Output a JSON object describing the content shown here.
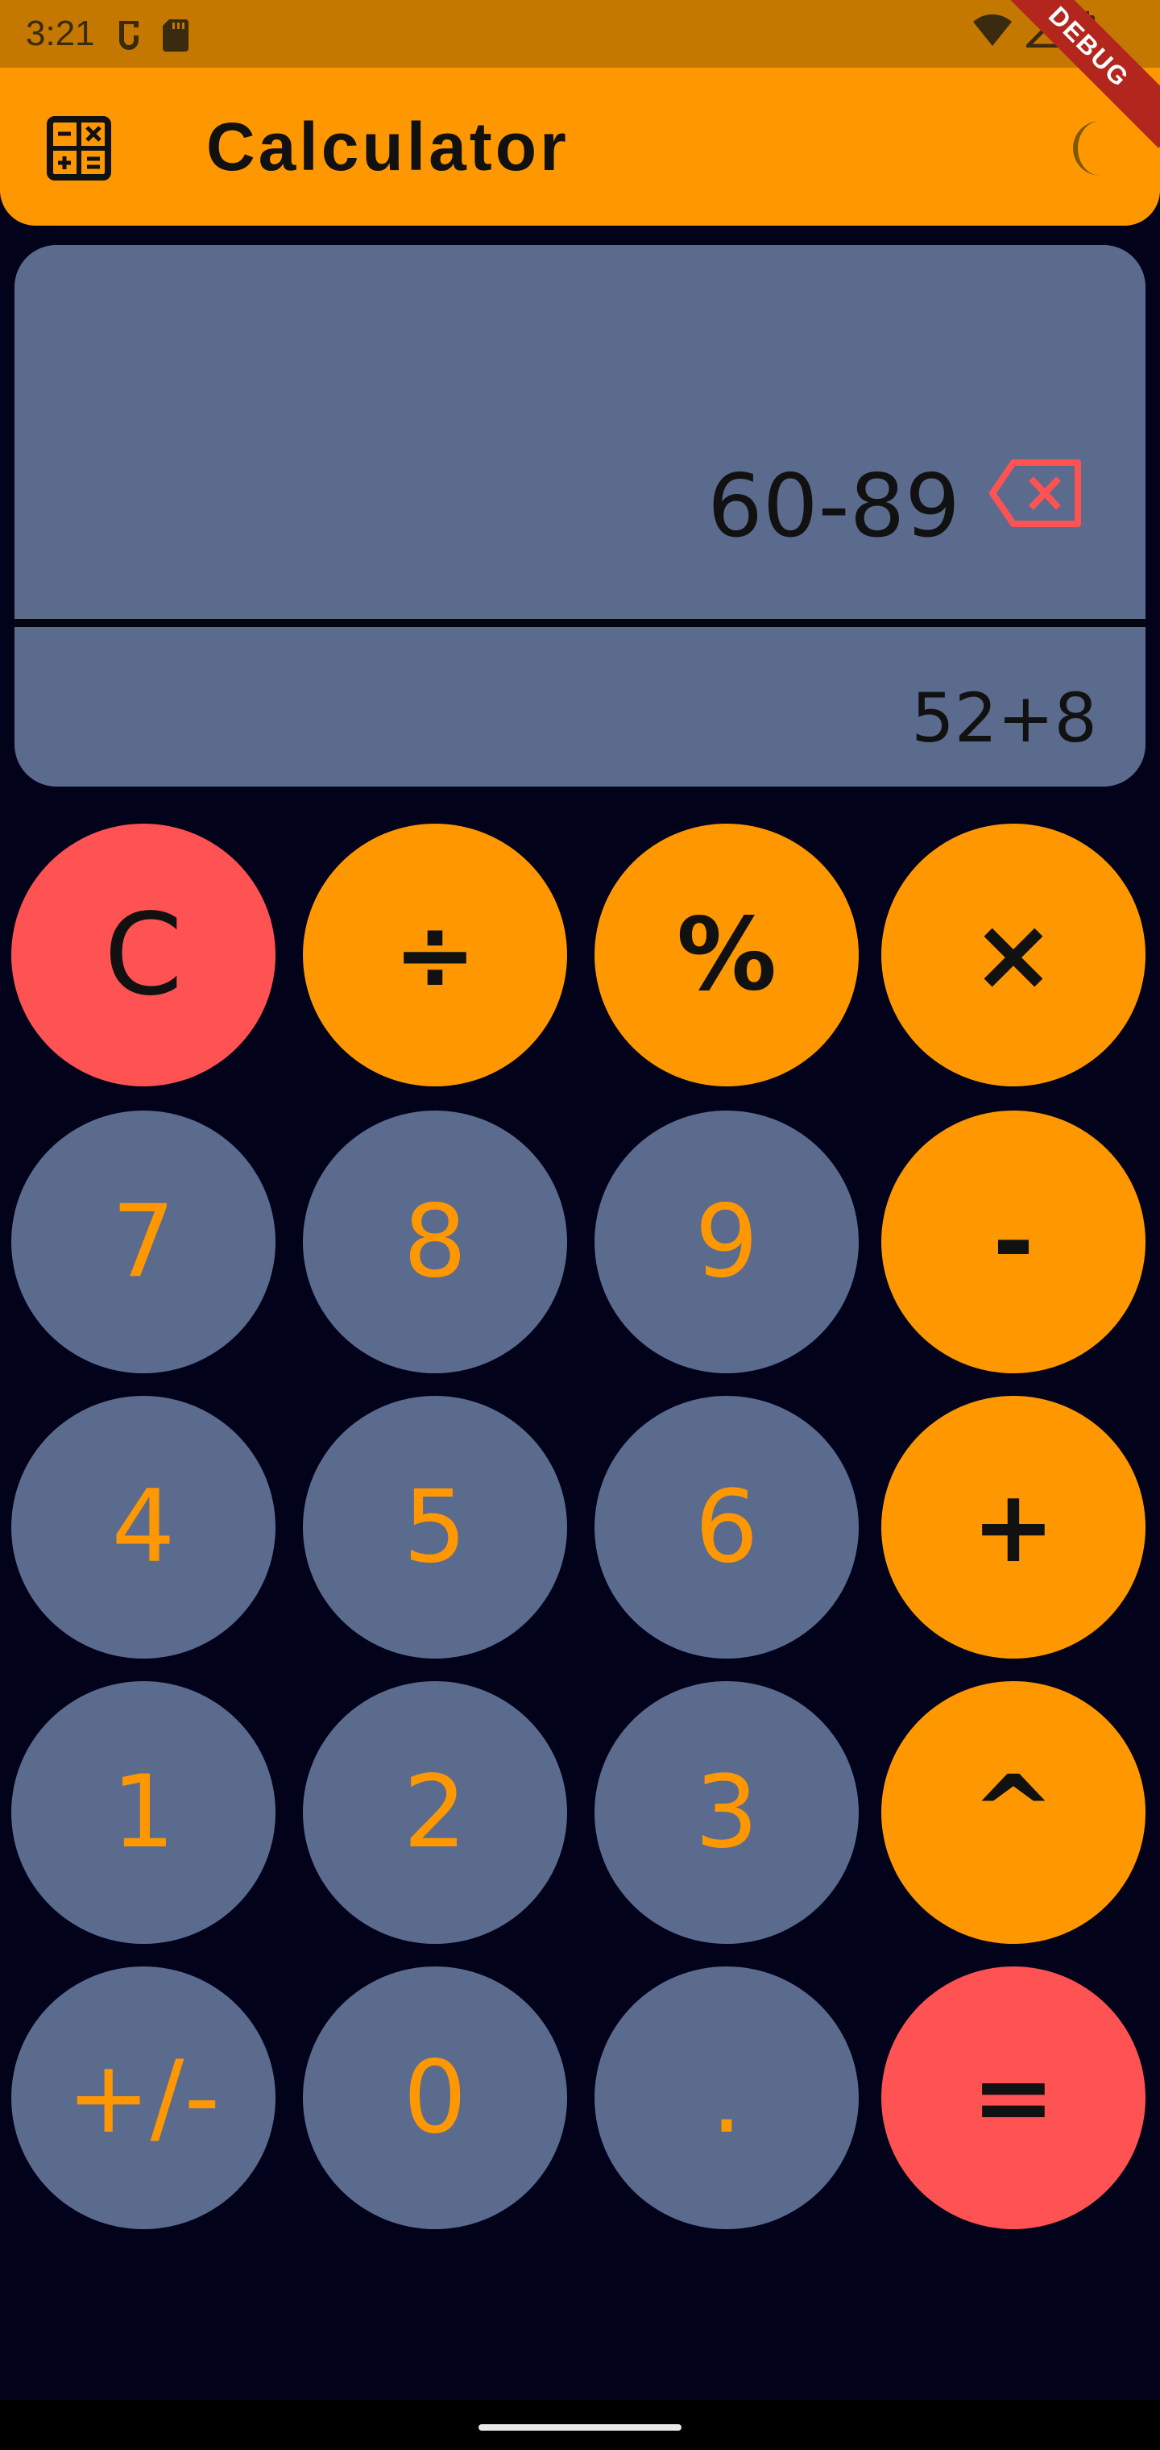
{
  "status_bar": {
    "time": "3:21",
    "icons": [
      "sim-icon",
      "sd-card-icon",
      "wifi-icon",
      "signal-icon",
      "battery-icon"
    ]
  },
  "app_bar": {
    "title": "Calculator",
    "leading_icon": "calculator-icon",
    "trailing_icon": "moon-icon",
    "debug_banner": "DEBUG"
  },
  "display": {
    "expression": "60-89",
    "history": "52+8",
    "backspace_icon": "backspace-icon"
  },
  "keypad": {
    "row1": [
      "C",
      "÷",
      "%",
      "×"
    ],
    "row2": [
      "7",
      "8",
      "9",
      "-"
    ],
    "row3": [
      "4",
      "5",
      "6",
      "+"
    ],
    "row4": [
      "1",
      "2",
      "3",
      "^"
    ],
    "row5": [
      "+/-",
      "0",
      ".",
      "="
    ]
  },
  "colors": {
    "accent": "#ff9800",
    "panel": "#5b6b8e",
    "danger": "#ff5252",
    "background": "#02021a"
  }
}
